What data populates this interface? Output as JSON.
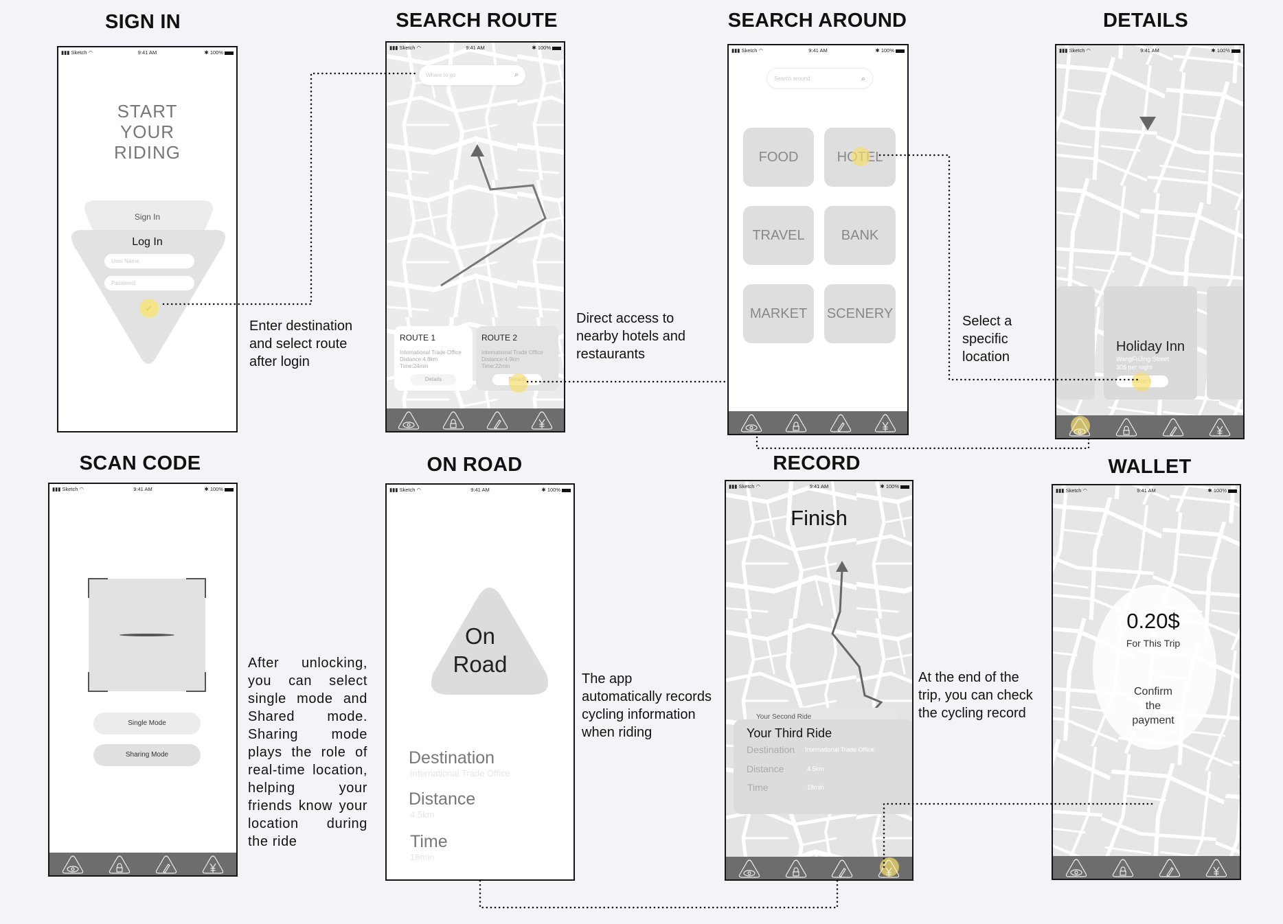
{
  "status": {
    "carrier": "Sketch",
    "time": "9:41 AM",
    "battery": "100%"
  },
  "tab_icons": [
    "eye-icon",
    "lock-icon",
    "pencil-icon",
    "yen-icon"
  ],
  "colors": {
    "highlight": "#f5de6e",
    "tabbar": "#6d6d6d",
    "map": "#e4e4e4",
    "background": "#f4f3f7"
  },
  "screens": {
    "sign_in": {
      "title": "SIGN IN",
      "headline": [
        "START",
        "YOUR",
        "RIDING"
      ],
      "sign_in": "Sign In",
      "log_in": "Log In",
      "username_placeholder": "User Name",
      "password_placeholder": "Password"
    },
    "search_route": {
      "title": "SEARCH ROUTE",
      "search_placeholder": "Where to go",
      "routes": [
        {
          "name": "ROUTE 1",
          "destination": "International Trade Office",
          "distance": "Distance:4.8km",
          "time": "Time:24min",
          "button": "Details"
        },
        {
          "name": "ROUTE 2",
          "destination": "International Trade Office",
          "distance": "Distance:4.9km",
          "time": "Time:22min",
          "button": "Details"
        }
      ]
    },
    "search_around": {
      "title": "SEARCH AROUND",
      "search_placeholder": "Search around",
      "categories": [
        "FOOD",
        "HOTEL",
        "TRAVEL",
        "BANK",
        "MARKET",
        "SCENERY"
      ]
    },
    "details": {
      "title": "DETAILS",
      "place": "Holiday Inn",
      "street": "WangFuJing Street",
      "price": "30$ per night",
      "button": "Select"
    },
    "scan_code": {
      "title": "SCAN CODE",
      "single_mode": "Single Mode",
      "sharing_mode": "Sharing Mode"
    },
    "on_road": {
      "title": "ON ROAD",
      "badge": [
        "On",
        "Road"
      ],
      "destination_label": "Destination",
      "destination_value": "International Trade Office",
      "distance_label": "Distance",
      "distance_value": "4.5km",
      "time_label": "Time",
      "time_value": "18min"
    },
    "record": {
      "title": "RECORD",
      "heading": "Finish",
      "previous_ride": "Your Second Ride",
      "ride_title": "Your Third Ride",
      "destination_label": "Destination",
      "destination_value": "International Trade Office",
      "distance_label": "Distance",
      "distance_value": "4.5km",
      "time_label": "Time",
      "time_value": "18min"
    },
    "wallet": {
      "title": "WALLET",
      "amount": "0.20$",
      "amount_caption": "For This Trip",
      "confirm": [
        "Confirm",
        "the",
        "payment"
      ]
    }
  },
  "notes": {
    "login_to_route": [
      "Enter destination",
      "and select route",
      "after login"
    ],
    "route_to_around": [
      "Direct access to",
      "nearby hotels and",
      "restaurants"
    ],
    "around_to_details": [
      "Select a",
      "specific",
      "location"
    ],
    "scan_code": "After unlocking, you can select single mode and Shared mode. Sharing mode plays the role of real-time location, helping your friends know your location during the ride",
    "on_road": [
      "The app",
      "automatically records",
      "cycling information",
      "when riding"
    ],
    "record": [
      "At the end of the",
      "trip, you can check",
      "the cycling record"
    ]
  }
}
